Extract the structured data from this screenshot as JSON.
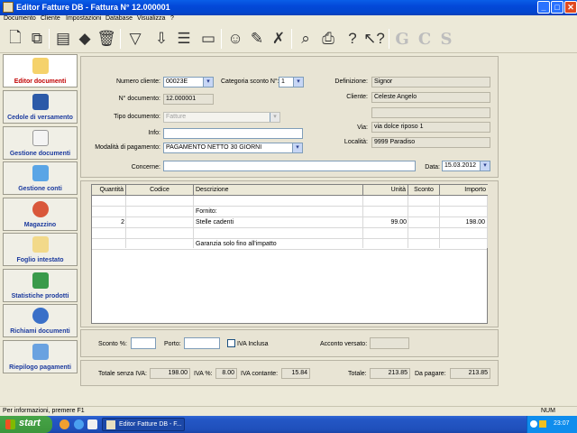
{
  "window": {
    "title": "Editor Fatture DB - Fattura N° 12.000001",
    "minimize": "_",
    "maximize": "□",
    "close": "✕"
  },
  "menu": [
    "Documento",
    "Cliente",
    "Impostazioni",
    "Database",
    "Visualizza",
    "?"
  ],
  "toolbar": {
    "icons": [
      "new-doc-icon",
      "copy-doc-icon",
      "folder-icon",
      "eraser-icon",
      "trash-icon",
      "filter-icon",
      "import-icon",
      "list-icon",
      "print-preview-icon",
      "user-icon",
      "user-edit-icon",
      "user-delete-icon",
      "search-icon",
      "printer-icon",
      "help-icon",
      "context-help-icon"
    ],
    "disabled_letters": [
      "G",
      "C",
      "S"
    ]
  },
  "sidebar": [
    {
      "label": "Editor documenti",
      "icon": "pencil-icon",
      "selected": true
    },
    {
      "label": "Cedole di versamento",
      "icon": "bank-icon"
    },
    {
      "label": "Gestione documenti",
      "icon": "documents-icon"
    },
    {
      "label": "Gestione conti",
      "icon": "accounts-icon"
    },
    {
      "label": "Magazzino",
      "icon": "warehouse-icon"
    },
    {
      "label": "Foglio intestato",
      "icon": "letterhead-icon"
    },
    {
      "label": "Statistiche prodotti",
      "icon": "stats-icon"
    },
    {
      "label": "Richiami documenti",
      "icon": "recall-icon"
    },
    {
      "label": "Riepilogo pagamenti",
      "icon": "payments-icon"
    }
  ],
  "form": {
    "numero_cliente_label": "Numero cliente:",
    "numero_cliente": "00023E",
    "categoria_label": "Categoria sconto N°:",
    "categoria": "1",
    "n_documento_label": "N° documento:",
    "n_documento": "12.000001",
    "tipo_label": "Tipo documento:",
    "tipo": "Fatture",
    "info_label": "Info:",
    "info": "",
    "pagamento_label": "Modalità di pagamento:",
    "pagamento": "PAGAMENTO NETTO 30 GIORNI",
    "concerne_label": "Concerne:",
    "concerne": "",
    "data_label": "Data:",
    "data": "15.03.2012",
    "definizione_label": "Definizione:",
    "definizione": "Signor",
    "cliente_label": "Cliente:",
    "cliente": "Celeste Angelo",
    "cliente2": "",
    "via_label": "Via:",
    "via": "via dolce riposo 1",
    "localita_label": "Località:",
    "localita": "9999 Paradiso"
  },
  "grid": {
    "headers": [
      "Quantità",
      "Codice",
      "Descrizione",
      "Unità",
      "Sconto",
      "Importo"
    ],
    "rows": [
      [
        "",
        "",
        "",
        "",
        "",
        ""
      ],
      [
        "",
        "",
        "Fornito:",
        "",
        "",
        ""
      ],
      [
        "2",
        "",
        "Stelle cadenti",
        "99.00",
        "",
        "198.00"
      ],
      [
        "",
        "",
        "",
        "",
        "",
        ""
      ],
      [
        "",
        "",
        "Garanzia solo fino all'impatto",
        "",
        "",
        ""
      ]
    ]
  },
  "footer": {
    "sconto_label": "Sconto %:",
    "sconto": "",
    "porto_label": "Porto:",
    "porto": "",
    "iva_inclusa_label": "IVA Inclusa",
    "acconto_label": "Acconto versato:",
    "acconto": ""
  },
  "totals": {
    "senza_iva_label": "Totale senza IVA:",
    "senza_iva": "198.00",
    "iva_pct_label": "IVA %:",
    "iva_pct": "8.00",
    "iva_contante_label": "IVA contante:",
    "iva_contante": "15.84",
    "totale_label": "Totale:",
    "totale": "213.85",
    "da_pagare_label": "Da pagare:",
    "da_pagare": "213.85"
  },
  "status": {
    "text": "Per informazioni, premere F1",
    "num": "NUM"
  },
  "taskbar": {
    "start": "start",
    "task": "Editor Fatture DB - F...",
    "clock": "23:07"
  }
}
